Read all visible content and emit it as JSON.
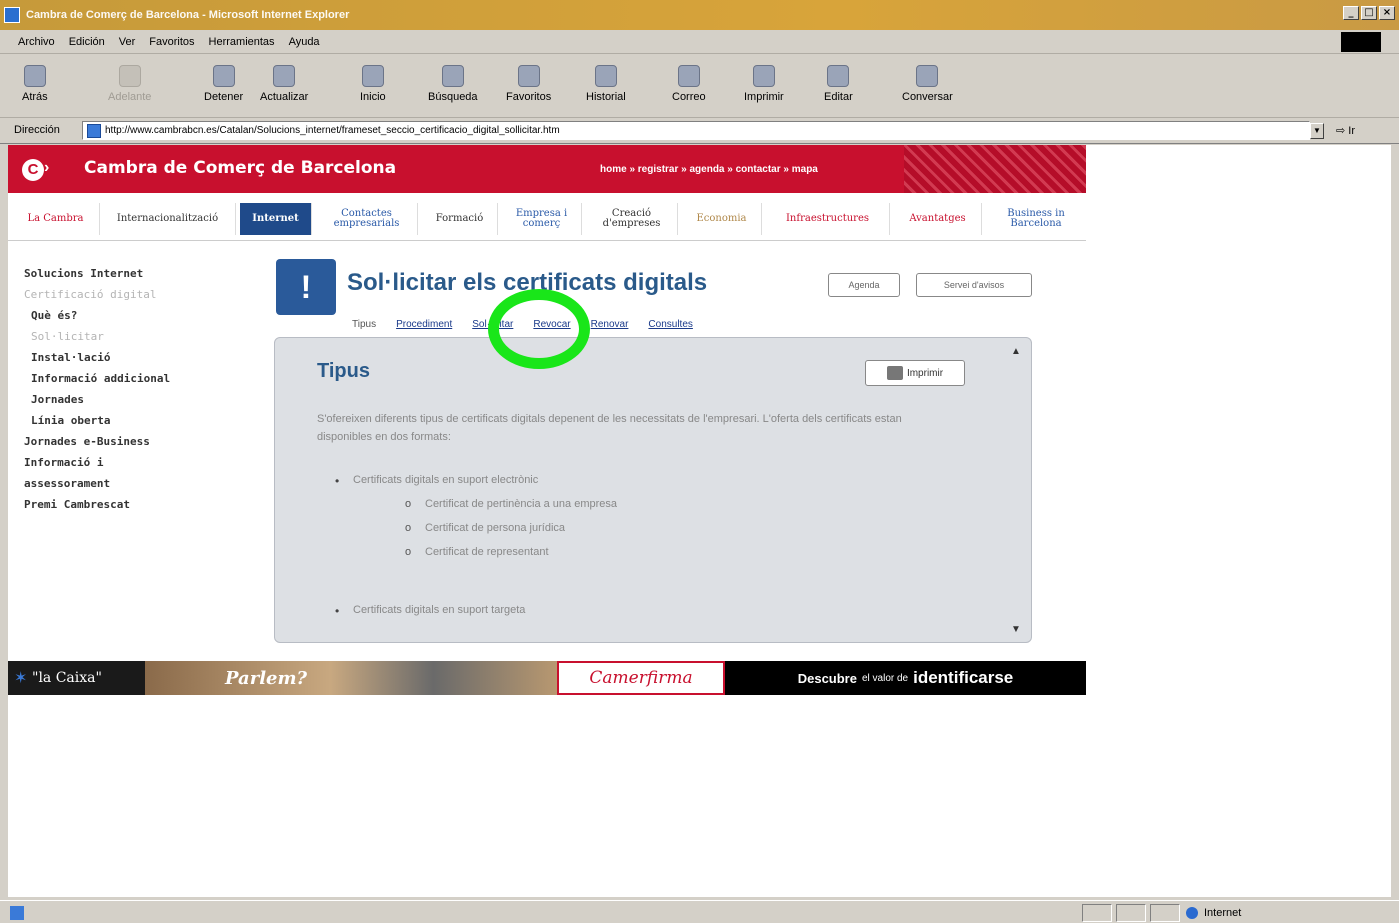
{
  "window": {
    "title": "Cambra de Comerç de Barcelona - Microsoft Internet Explorer"
  },
  "menu": [
    "Archivo",
    "Edición",
    "Ver",
    "Favoritos",
    "Herramientas",
    "Ayuda"
  ],
  "toolbar": {
    "back": "Atrás",
    "forward": "Adelante",
    "stop": "Detener",
    "refresh": "Actualizar",
    "home": "Inicio",
    "search": "Búsqueda",
    "favorites": "Favoritos",
    "history": "Historial",
    "mail": "Correo",
    "print": "Imprimir",
    "edit": "Editar",
    "discuss": "Conversar"
  },
  "address": {
    "label": "Dirección",
    "url": "http://www.cambrabcn.es/Catalan/Solucions_internet/frameset_seccio_certificacio_digital_sollicitar.htm",
    "go": "Ir"
  },
  "site": {
    "title": "Cambra de Comerç de Barcelona",
    "top_links": "home » registrar » agenda » contactar » mapa",
    "nav": [
      "La Cambra",
      "Internacionalització",
      "Internet",
      "Contactes empresarials",
      "Formació",
      "Empresa i comerç",
      "Creació d'empreses",
      "Economia",
      "Infraestructures",
      "Avantatges",
      "Business in Barcelona"
    ]
  },
  "sidebar": [
    "Solucions Internet",
    "Certificació digital",
    "Què és?",
    "Sol·licitar",
    "Instal·lació",
    "Informació addicional",
    "Jornades",
    "Línia oberta",
    "Jornades e-Business",
    "Informació i",
    "assessorament",
    "Premi Cambrescat"
  ],
  "content": {
    "title": "Sol·licitar els certificats digitals",
    "btn_agenda": "Agenda",
    "btn_servei": "Servei d'avisos",
    "subtabs": [
      "Tipus",
      "Procediment",
      "Sol·licitar",
      "Revocar",
      "Renovar",
      "Consultes"
    ],
    "panel_title": "Tipus",
    "print_label": "Imprimir",
    "intro": "S'ofereixen diferents tipus de certificats digitals depenent de les necessitats de l'empresari. L'oferta dels certificats estan disponibles en dos formats:",
    "list": {
      "item1": "Certificats digitals en suport electrònic",
      "item1_sub": [
        "Certificat de pertinència a una empresa",
        "Certificat de persona jurídica",
        "Certificat de representant"
      ],
      "item2": "Certificats digitals en suport targeta"
    }
  },
  "banner": {
    "caixa": "\"la Caixa\"",
    "parlem": "Parlem?",
    "camerfirma": "Camerfirma",
    "descubre": "Descubre",
    "el_valor_de": "el valor de",
    "identificarse": "identificarse"
  },
  "status": {
    "zone": "Internet"
  }
}
